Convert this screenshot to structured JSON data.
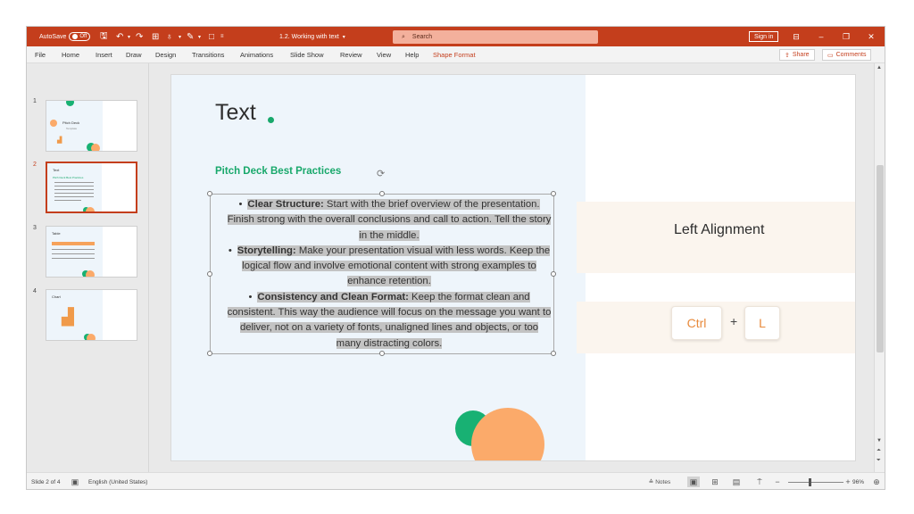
{
  "titlebar": {
    "autosave_label": "AutoSave",
    "autosave_state": "Off",
    "doc_title": "1.2. Working with text",
    "search_placeholder": "Search",
    "signin_label": "Sign in",
    "background": "#c43e1c"
  },
  "menu": {
    "items": [
      "File",
      "Home",
      "Insert",
      "Draw",
      "Design",
      "Transitions",
      "Animations",
      "Slide Show",
      "Review",
      "View",
      "Help",
      "Shape Format"
    ],
    "active_item": "Shape Format",
    "share_label": "Share",
    "comments_label": "Comments"
  },
  "thumbnails": [
    {
      "number": "1",
      "title": "Pitch Deck",
      "subtitle": "Template"
    },
    {
      "number": "2",
      "title": "Text",
      "subtitle": "Pitch Deck Best Practices"
    },
    {
      "number": "3",
      "title": "Table"
    },
    {
      "number": "4",
      "title": "Chart"
    }
  ],
  "slide": {
    "title": "Text",
    "subtitle": "Pitch Deck Best Practices",
    "bullets": [
      {
        "bold": "Clear Structure:",
        "text": " Start with the brief overview of the presentation. Finish strong with the overall conclusions and call to action. Tell the story in the middle."
      },
      {
        "bold": "Storytelling:",
        "text": " Make your presentation visual with less words. Keep the logical flow and involve emotional content with strong examples to enhance retention."
      },
      {
        "bold": "Consistency and Clean Format:",
        "text": " Keep the format clean and consistent. This way the audience will focus on the message you want to deliver, not on a variety of fonts, unaligned lines and objects, or too many distracting colors."
      }
    ],
    "shortcut_label": "Left Alignment",
    "key_ctrl": "Ctrl",
    "key_plus": "+",
    "key_l": "L",
    "accent_green": "#18a86b",
    "accent_orange": "#fbaa6a"
  },
  "status": {
    "slide_info": "Slide 2 of 4",
    "language": "English (United States)",
    "notes_label": "Notes",
    "zoom": "96%"
  }
}
